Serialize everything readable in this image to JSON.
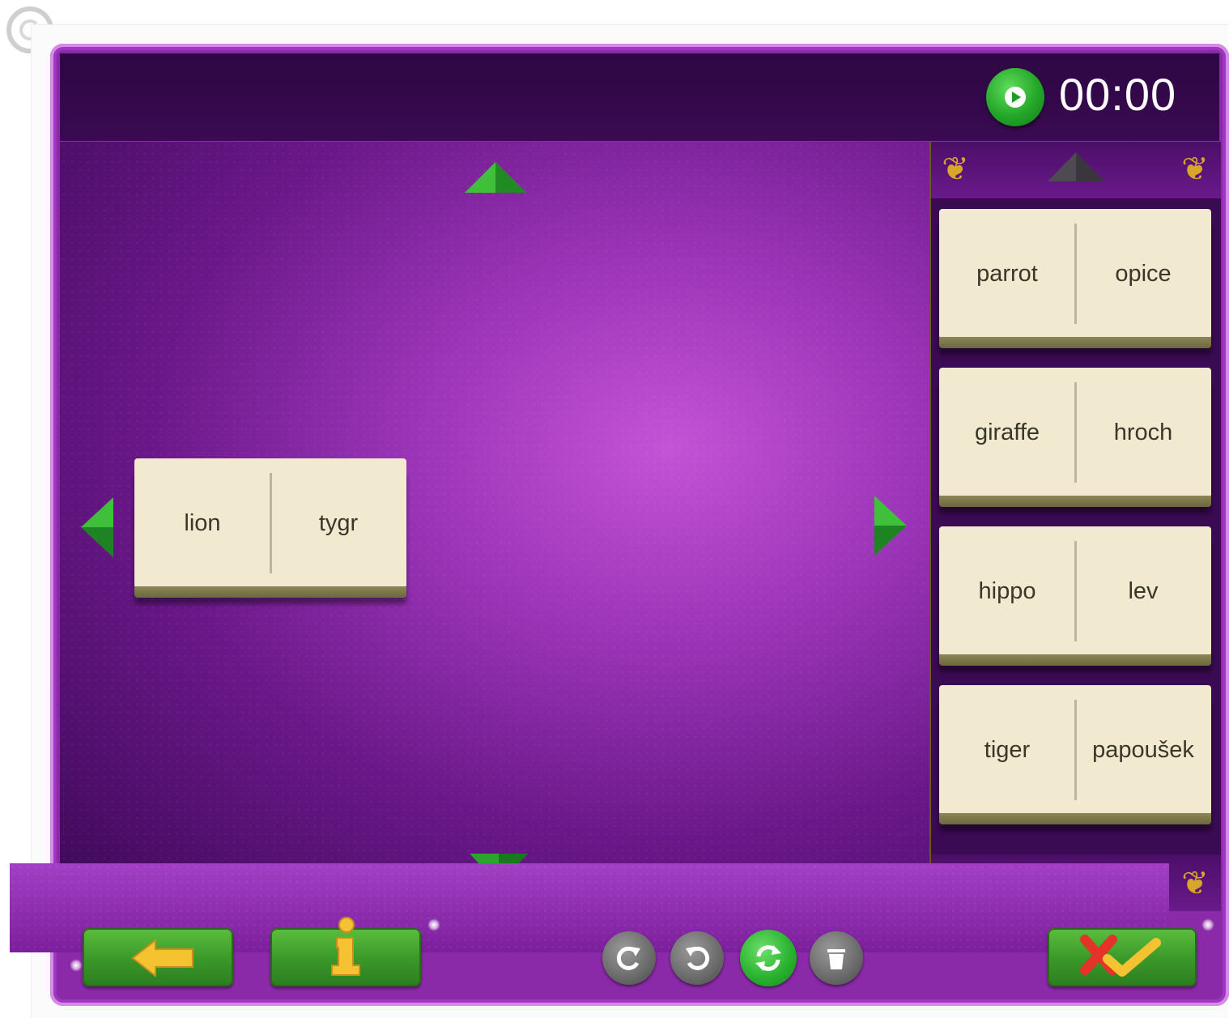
{
  "timer": {
    "value": "00:00"
  },
  "board": {
    "placed_tiles": [
      {
        "left": "lion",
        "right": "tygr"
      }
    ]
  },
  "tray": {
    "tiles": [
      {
        "left": "parrot",
        "right": "opice"
      },
      {
        "left": "giraffe",
        "right": "hroch"
      },
      {
        "left": "hippo",
        "right": "lev"
      },
      {
        "left": "tiger",
        "right": "papoušek"
      }
    ]
  },
  "icons": {
    "play": "play-icon",
    "back": "back-arrow-icon",
    "info": "info-icon",
    "undo": "undo-icon",
    "redo": "redo-icon",
    "restart": "restart-icon",
    "delete": "trash-icon",
    "check": "check-cross-icon"
  },
  "colors": {
    "background": "#8a2aa8",
    "tile": "#f1ead0",
    "accent_green": "#2bb330",
    "ornament_gold": "#d8a62a"
  }
}
